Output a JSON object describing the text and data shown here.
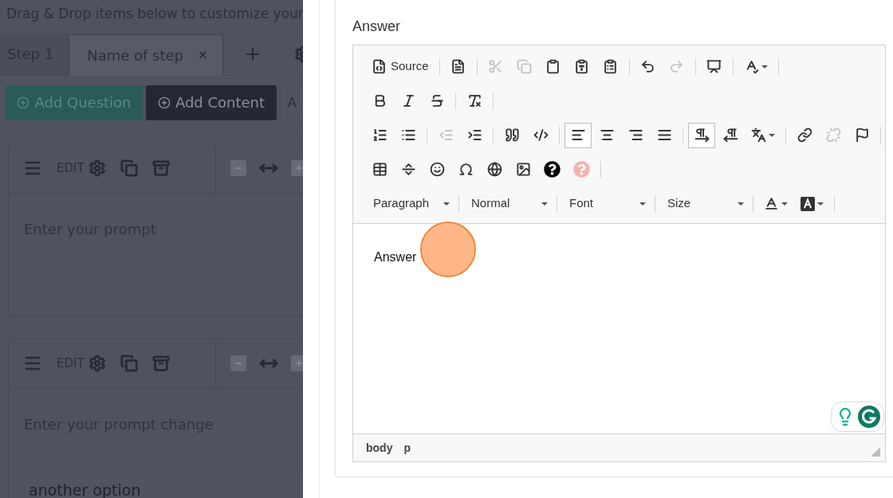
{
  "instructions": "Drag & Drop items below to customize your",
  "step_tabs": [
    {
      "label": "Step 1",
      "selected": false
    },
    {
      "label": "Name of step",
      "selected": true,
      "close": "×"
    }
  ],
  "action_buttons": [
    {
      "label": "Add Question",
      "kind": "success"
    },
    {
      "label": "Add Content",
      "kind": "dark"
    },
    {
      "label": "A",
      "kind": "outline"
    }
  ],
  "question_cards": [
    {
      "edit": "EDIT",
      "placeholder": "Enter your prompt"
    },
    {
      "edit": "EDIT",
      "placeholder": "Enter your prompt change",
      "options": [
        "another option"
      ]
    }
  ],
  "answer_panel": {
    "label": "Answer",
    "editor": {
      "toolbar": [
        [
          [
            {
              "kind": "button",
              "label": "Source",
              "disabled": false
            }
          ],
          [
            {
              "kind": "button",
              "disabled": false
            }
          ],
          [
            {
              "kind": "button",
              "disabled": true
            },
            {
              "kind": "button",
              "disabled": true
            },
            {
              "kind": "button",
              "disabled": false
            },
            {
              "kind": "button",
              "disabled": false
            },
            {
              "kind": "button",
              "disabled": false
            }
          ],
          [
            {
              "kind": "button",
              "disabled": false
            },
            {
              "kind": "button",
              "disabled": true
            }
          ],
          [
            {
              "kind": "button",
              "disabled": false
            }
          ],
          [
            {
              "kind": "button",
              "disabled": false
            }
          ]
        ],
        [
          [
            {
              "kind": "button",
              "disabled": false
            },
            {
              "kind": "button",
              "disabled": false
            },
            {
              "kind": "button",
              "disabled": false
            }
          ],
          [
            {
              "kind": "button",
              "disabled": false
            }
          ]
        ],
        [
          [
            {
              "kind": "button",
              "disabled": false
            },
            {
              "kind": "button",
              "disabled": false
            }
          ],
          [
            {
              "kind": "button",
              "disabled": true
            },
            {
              "kind": "button",
              "disabled": false
            }
          ],
          [
            {
              "kind": "button",
              "disabled": false
            },
            {
              "kind": "button",
              "disabled": false
            }
          ],
          [
            {
              "kind": "button",
              "disabled": false,
              "selected": true
            },
            {
              "kind": "button",
              "disabled": false,
              "selected": false
            },
            {
              "kind": "button",
              "disabled": false,
              "selected": false
            },
            {
              "kind": "button",
              "disabled": false,
              "selected": false
            }
          ],
          [
            {
              "kind": "button",
              "disabled": false,
              "selected": true
            },
            {
              "kind": "button",
              "disabled": false,
              "selected": false
            },
            {
              "kind": "button",
              "disabled": false
            }
          ],
          [
            {
              "kind": "button",
              "disabled": false
            },
            {
              "kind": "button",
              "disabled": true
            },
            {
              "kind": "button",
              "disabled": false
            }
          ]
        ],
        [
          [
            {
              "kind": "button",
              "disabled": false
            },
            {
              "kind": "button",
              "disabled": false
            },
            {
              "kind": "button",
              "disabled": false
            },
            {
              "kind": "button",
              "disabled": false
            },
            {
              "kind": "button",
              "disabled": false
            },
            {
              "kind": "button",
              "disabled": false
            },
            {
              "kind": "button",
              "disabled": false
            },
            {
              "kind": "button",
              "disabled": true
            }
          ]
        ],
        [
          [
            {
              "kind": "combo",
              "label": "Paragraph"
            }
          ],
          [
            {
              "kind": "combo",
              "label": "Normal"
            }
          ],
          [
            {
              "kind": "combo",
              "label": "Font"
            }
          ],
          [
            {
              "kind": "combo",
              "label": "Size"
            }
          ],
          [
            {
              "kind": "button",
              "disabled": false
            },
            {
              "kind": "button",
              "disabled": false
            }
          ]
        ]
      ],
      "content": "Answer",
      "path": [
        "body",
        "p"
      ]
    }
  }
}
